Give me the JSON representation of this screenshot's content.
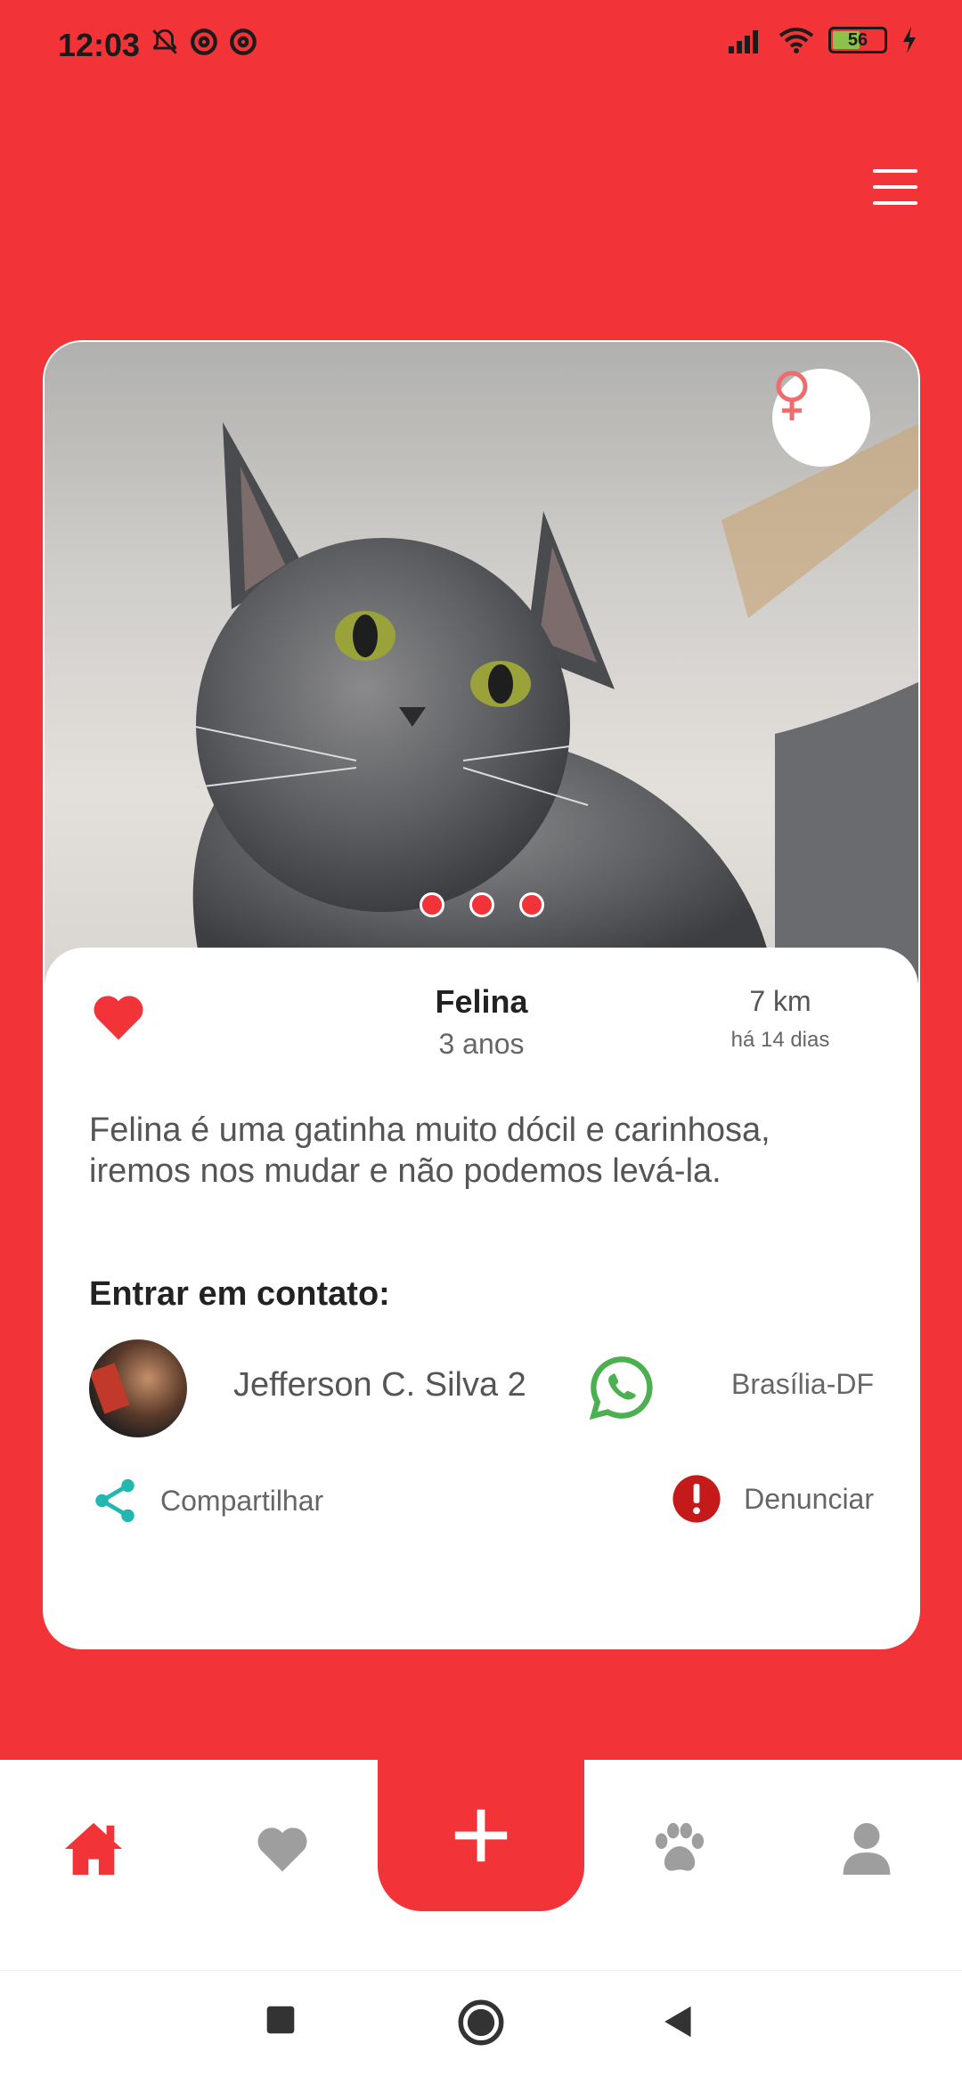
{
  "status_bar": {
    "time": "12:03",
    "battery_level": "56",
    "battery_color": "#8bc34a"
  },
  "header": {
    "menu_icon": "hamburger-menu-icon"
  },
  "pet": {
    "name": "Felina",
    "age": "3 anos",
    "distance": "7 km",
    "posted": "há 14 dias",
    "gender_icon": "female-icon",
    "description": "Felina é uma gatinha muito dócil e carinhosa, iremos nos mudar e não podemos levá-la.",
    "photo_count": 3,
    "favorite_icon": "heart-icon"
  },
  "contact": {
    "title": "Entrar em contato:",
    "owner_name": "Jefferson C. Silva 2",
    "city": "Brasília-DF",
    "whatsapp_icon": "whatsapp-icon",
    "share_label": "Compartilhar",
    "report_label": "Denunciar"
  },
  "bottom_nav": {
    "items": [
      "home-icon",
      "heart-icon",
      "plus-icon",
      "paw-icon",
      "user-icon"
    ],
    "active": "home-icon"
  },
  "colors": {
    "accent": "#f23337",
    "teal": "#22b8b0",
    "whatsapp": "#4caf50",
    "report": "#c41a1a",
    "inactive": "#9e9e9e"
  }
}
